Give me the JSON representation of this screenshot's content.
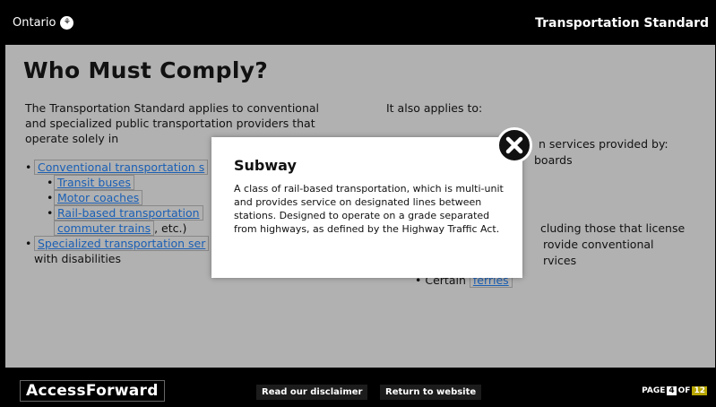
{
  "header": {
    "brand": "Ontario",
    "logo_glyph": "⚘",
    "title": "Transportation Standard"
  },
  "main": {
    "heading": "Who Must Comply?",
    "left_intro": "The Transportation Standard applies to conventional and specialized public transportation providers that operate solely in",
    "list": [
      {
        "text": "Conventional transportation s"
      },
      {
        "text": "Transit buses"
      },
      {
        "text": "Motor coaches"
      },
      {
        "text": "Rail-based transportation"
      },
      {
        "link": "commuter trains",
        "rest": ", etc.)"
      },
      {
        "link": "Specialized transportation ser",
        "rest": "with disabilities"
      }
    ],
    "right_intro": "It also applies to:",
    "right_fragments": [
      "n services provided by:",
      "boards",
      "cluding those that license",
      "rovide conventional",
      "rvices",
      "Certain"
    ],
    "right_link": "ferries"
  },
  "modal": {
    "title": "Subway",
    "body": "A class of rail-based transportation, which is multi-unit and provides service on designated lines between stations. Designed to operate on a grade separated from highways, as defined by the Highway Traffic Act."
  },
  "footer": {
    "brand": "AccessForward",
    "disclaimer": "Read our disclaimer",
    "return": "Return to website",
    "page_label": "PAGE",
    "page_num": "4",
    "of_label": "OF",
    "page_total": "12"
  }
}
